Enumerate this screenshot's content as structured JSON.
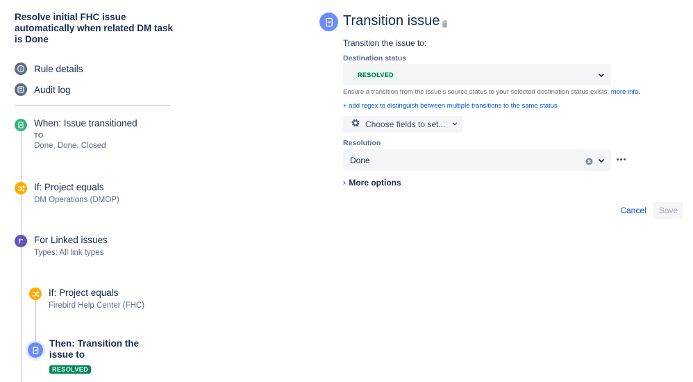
{
  "rule": {
    "title": "Resolve initial FHC issue automatically when related DM task is Done"
  },
  "nav": {
    "rule_details": "Rule details",
    "audit_log": "Audit log"
  },
  "steps": {
    "trigger": {
      "title": "When: Issue transitioned",
      "key": "TO",
      "detail": "Done, Done, Closed"
    },
    "condition1": {
      "title": "If: Project equals",
      "detail": "DM Operations (DMOP)"
    },
    "branch": {
      "title": "For Linked issues",
      "detail": "Types: All link types"
    },
    "condition2": {
      "title": "If: Project equals",
      "detail": "Firebird Help Center (FHC)"
    },
    "action": {
      "title": "Then: Transition the issue to",
      "badge": "RESOLVED"
    }
  },
  "editor": {
    "title": "Transition issue",
    "subtitle": "Transition the issue to:",
    "destination_label": "Destination status",
    "destination_value": "RESOLVED",
    "help_text": "Ensure a transition from the issue's source status to your selected destination status exists;",
    "help_link": "more info.",
    "regex_link": "+ add regex to distinguish between multiple transitions to the same status",
    "choose_fields": "Choose fields to set...",
    "resolution_label": "Resolution",
    "resolution_value": "Done",
    "more_options": "More options",
    "cancel": "Cancel",
    "save": "Save"
  },
  "colors": {
    "accent": "#0052CC",
    "trigger_green": "#36B37E",
    "condition_orange": "#FFAB00",
    "branch_purple": "#6554C0",
    "action_blue": "#6B8CF7"
  },
  "icons": {
    "rule_details": "info-icon",
    "audit_log": "list-icon",
    "trigger": "document-icon",
    "condition": "shuffle-icon",
    "branch": "branch-icon",
    "action": "document-icon",
    "trash": "trash-icon",
    "gear": "gear-icon"
  }
}
